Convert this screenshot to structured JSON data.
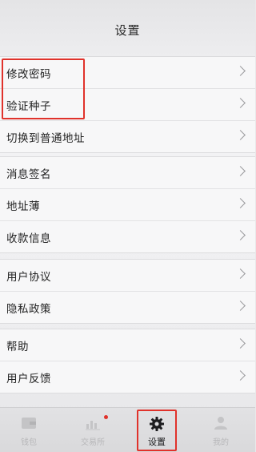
{
  "header": {
    "title": "设置"
  },
  "groups": [
    {
      "items": [
        {
          "label": "修改密码"
        },
        {
          "label": "验证种子"
        },
        {
          "label": "切换到普通地址"
        }
      ]
    },
    {
      "items": [
        {
          "label": "消息签名"
        },
        {
          "label": "地址薄"
        },
        {
          "label": "收款信息"
        }
      ]
    },
    {
      "items": [
        {
          "label": "用户协议"
        },
        {
          "label": "隐私政策"
        }
      ]
    },
    {
      "items": [
        {
          "label": "帮助"
        },
        {
          "label": "用户反馈"
        }
      ]
    }
  ],
  "tabbar": {
    "tabs": [
      {
        "label": "钱包",
        "icon": "wallet-icon",
        "active": false
      },
      {
        "label": "交易所",
        "icon": "exchange-chart-icon",
        "active": false,
        "badge": true
      },
      {
        "label": "设置",
        "icon": "gear-icon",
        "active": true
      },
      {
        "label": "我的",
        "icon": "person-icon",
        "active": false
      }
    ]
  },
  "colors": {
    "highlight": "#e0322b",
    "badge": "#e0322b",
    "active_tab_text": "#1d1d1f",
    "inactive_tab_text": "#b7b7b9"
  }
}
